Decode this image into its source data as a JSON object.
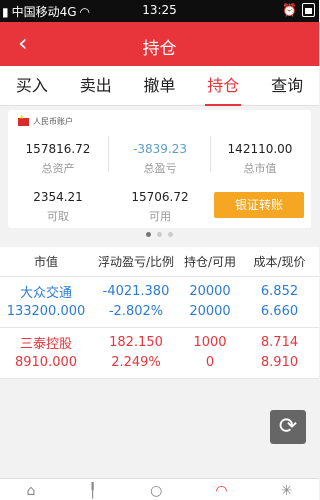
{
  "status_bar": {
    "carrier": "中国移动4G",
    "time": "13:25"
  },
  "header": {
    "back_icon": "‹",
    "title": "持仓"
  },
  "tabs": [
    {
      "label": "买入",
      "active": false
    },
    {
      "label": "卖出",
      "active": false
    },
    {
      "label": "撤单",
      "active": false
    },
    {
      "label": "持仓",
      "active": true
    },
    {
      "label": "查询",
      "active": false
    }
  ],
  "account": {
    "name": "人民币账户",
    "total_assets": {
      "value": "157816.72",
      "label": "总资产"
    },
    "total_pnl": {
      "value": "-3839.23",
      "label": "总盈亏"
    },
    "market_value": {
      "value": "142110.00",
      "label": "总市值"
    },
    "withdrawable": {
      "value": "2354.21",
      "label": "可取"
    },
    "available": {
      "value": "15706.72",
      "label": "可用"
    },
    "transfer_button": "银证转账"
  },
  "pager": {
    "pages": 3,
    "active": 0
  },
  "holdings": {
    "headers": [
      "市值",
      "浮动盈亏/比例",
      "持仓/可用",
      "成本/现价"
    ],
    "rows": [
      {
        "name": "大众交通",
        "market_value": "133200.000",
        "pnl": "-4021.380",
        "pnl_pct": "-2.802%",
        "hold": "20000",
        "avail": "20000",
        "cost": "6.852",
        "price": "6.660",
        "color": "blue"
      },
      {
        "name": "三泰控股",
        "market_value": "8910.000",
        "pnl": "182.150",
        "pnl_pct": "2.249%",
        "hold": "1000",
        "avail": "0",
        "cost": "8.714",
        "price": "8.910",
        "color": "red"
      }
    ]
  },
  "colors": {
    "accent": "#e8343b",
    "loss": "#2b7bd6",
    "gain": "#e8343b",
    "button": "#f5a623"
  }
}
